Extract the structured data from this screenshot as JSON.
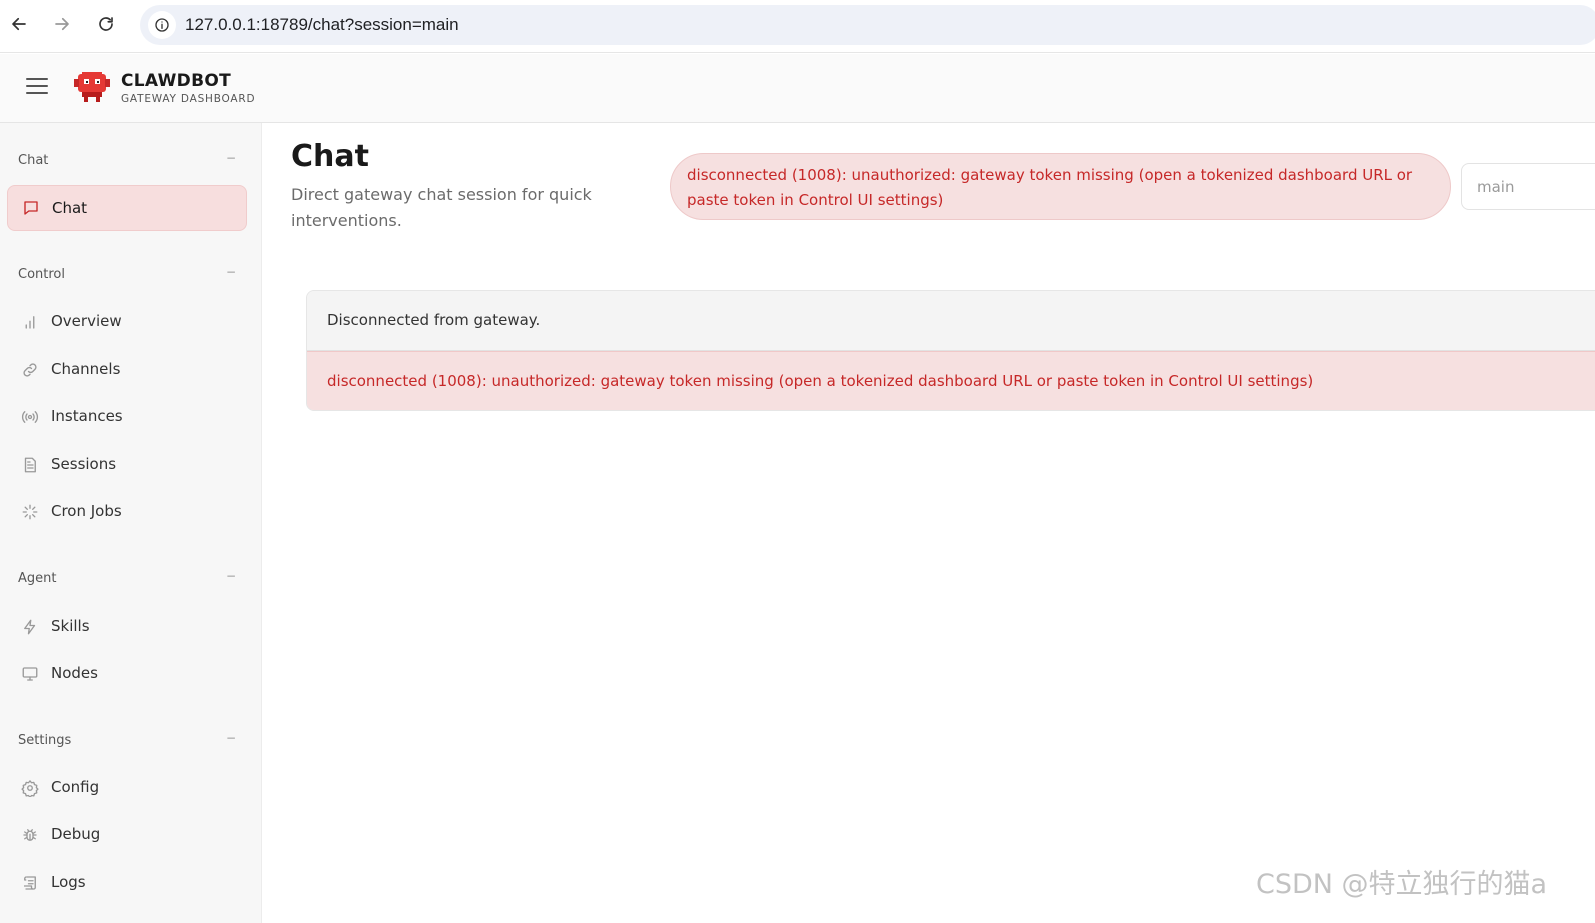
{
  "browser": {
    "url": "127.0.0.1:18789/chat?session=main"
  },
  "header": {
    "brand_title": "CLAWDBOT",
    "brand_subtitle": "GATEWAY DASHBOARD"
  },
  "sidebar": {
    "sections": [
      {
        "label": "Chat",
        "collapse": "−"
      },
      {
        "label": "Control",
        "collapse": "−"
      },
      {
        "label": "Agent",
        "collapse": "−"
      },
      {
        "label": "Settings",
        "collapse": "−"
      }
    ],
    "items": [
      {
        "label": "Chat",
        "icon": "message-square-icon",
        "active": true
      },
      {
        "label": "Overview",
        "icon": "bar-chart-icon"
      },
      {
        "label": "Channels",
        "icon": "link-icon"
      },
      {
        "label": "Instances",
        "icon": "radio-icon"
      },
      {
        "label": "Sessions",
        "icon": "file-text-icon"
      },
      {
        "label": "Cron Jobs",
        "icon": "loader-icon"
      },
      {
        "label": "Skills",
        "icon": "zap-icon"
      },
      {
        "label": "Nodes",
        "icon": "monitor-icon"
      },
      {
        "label": "Config",
        "icon": "settings-icon"
      },
      {
        "label": "Debug",
        "icon": "bug-icon"
      },
      {
        "label": "Logs",
        "icon": "scroll-icon"
      }
    ]
  },
  "main": {
    "title": "Chat",
    "subtitle": "Direct gateway chat session for quick interventions.",
    "error_banner": "disconnected (1008): unauthorized: gateway token missing (open a tokenized dashboard URL or paste token in Control UI settings)",
    "session_value": "main",
    "status_message": "Disconnected from gateway.",
    "error_message": "disconnected (1008): unauthorized: gateway token missing (open a tokenized dashboard URL or paste token in Control UI settings)"
  },
  "watermark": "CSDN @特立独行的猫a",
  "colors": {
    "accent": "#c62828",
    "error_bg": "#f6e0e0",
    "active_bg": "#f7dede"
  }
}
